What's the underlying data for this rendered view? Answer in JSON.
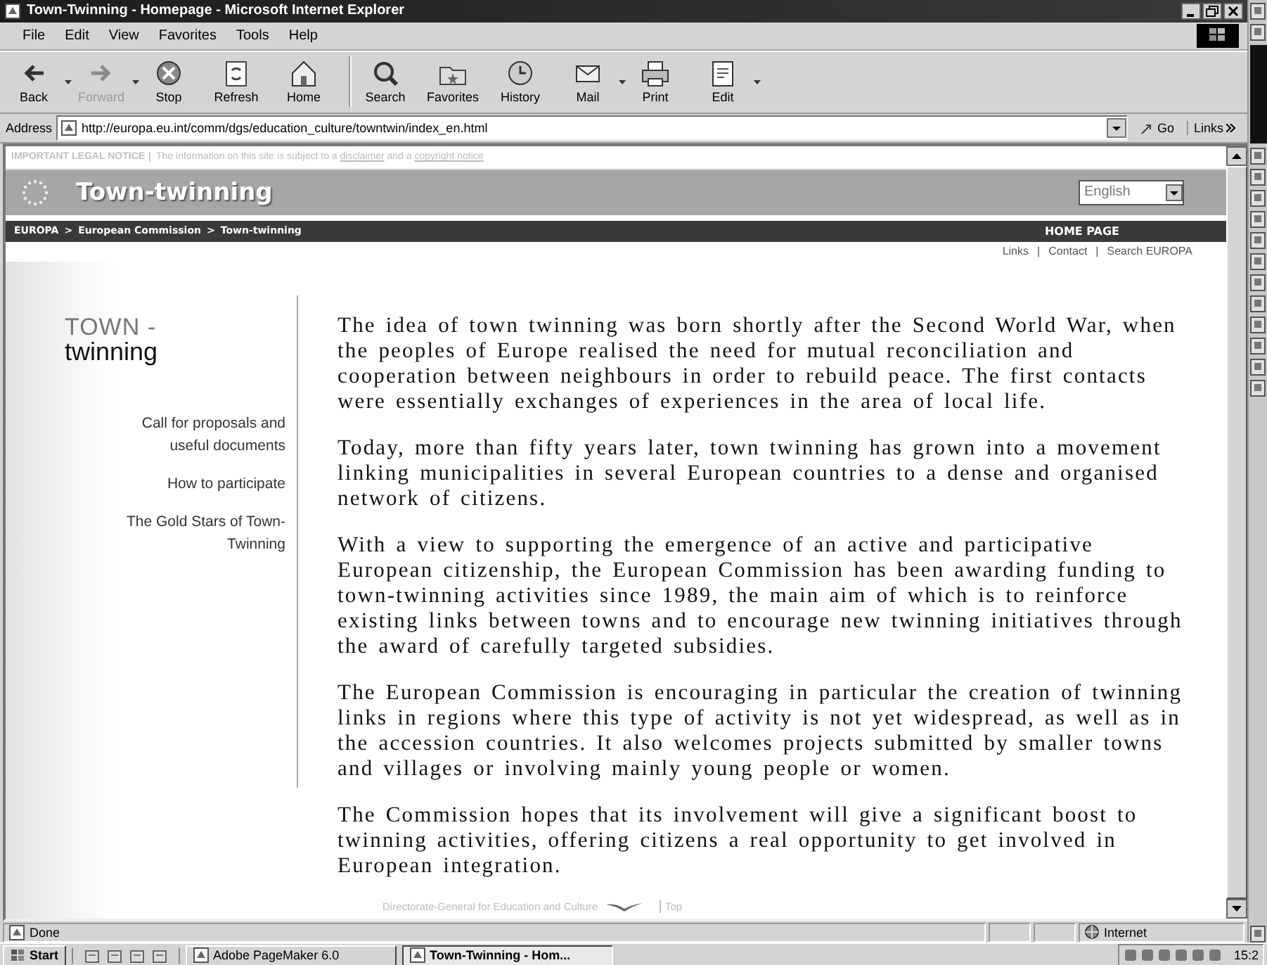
{
  "window": {
    "title": "Town-Twinning - Homepage - Microsoft Internet Explorer"
  },
  "menu": [
    "File",
    "Edit",
    "View",
    "Favorites",
    "Tools",
    "Help"
  ],
  "toolbar": [
    {
      "label": "Back",
      "kind": "back",
      "disabled": false,
      "dropdown": true
    },
    {
      "label": "Forward",
      "kind": "forward",
      "disabled": true,
      "dropdown": true
    },
    {
      "label": "Stop",
      "kind": "stop",
      "disabled": false,
      "dropdown": false
    },
    {
      "label": "Refresh",
      "kind": "refresh",
      "disabled": false,
      "dropdown": false
    },
    {
      "label": "Home",
      "kind": "home",
      "disabled": false,
      "dropdown": false
    },
    {
      "label": "Search",
      "kind": "search",
      "disabled": false,
      "dropdown": false
    },
    {
      "label": "Favorites",
      "kind": "favorites",
      "disabled": false,
      "dropdown": false
    },
    {
      "label": "History",
      "kind": "history",
      "disabled": false,
      "dropdown": false
    },
    {
      "label": "Mail",
      "kind": "mail",
      "disabled": false,
      "dropdown": true
    },
    {
      "label": "Print",
      "kind": "print",
      "disabled": false,
      "dropdown": false
    },
    {
      "label": "Edit",
      "kind": "edit",
      "disabled": false,
      "dropdown": true
    }
  ],
  "address": {
    "label": "Address",
    "value": "http://europa.eu.int/comm/dgs/education_culture/towntwin/index_en.html",
    "go": "Go",
    "links": "Links"
  },
  "page": {
    "legal_notice": {
      "label": "IMPORTANT LEGAL NOTICE",
      "parts": [
        {
          "text": "The information on this site is subject to a",
          "link": false
        },
        {
          "text": "disclaimer",
          "link": true
        },
        {
          "text": "and a",
          "link": false
        },
        {
          "text": "copyright notice",
          "link": true
        }
      ]
    },
    "site_title": "Town-twinning",
    "language": "English",
    "breadcrumb": [
      "EUROPA",
      "European Commission",
      "Town-twinning"
    ],
    "breadcrumb_separator": ">",
    "home_page": "HOME PAGE",
    "top_links": [
      "Links",
      "Contact",
      "Search EUROPA"
    ],
    "top_links_separator": "|",
    "side_title": [
      "TOWN -",
      "twinning"
    ],
    "nav": [
      "Call for proposals and useful documents",
      "How to participate",
      "The Gold Stars of Town-Twinning"
    ],
    "paragraphs": [
      "The idea of town twinning was born shortly after the Second World War, when the peoples of Europe realised the need for mutual reconciliation and cooperation between neighbours in order to rebuild peace. The first contacts were essentially exchanges of experiences in the area of local life.",
      "Today, more than fifty years later, town twinning has grown into a movement linking municipalities in several European countries to a dense and organised network of citizens.",
      "With a view to supporting the emergence of an active and participative European citizenship, the European Commission has been awarding funding to town-twinning activities since 1989, the main aim of which is to reinforce existing links between towns and to encourage new twinning initiatives through the award of carefully targeted subsidies.",
      "The European Commission is encouraging in particular the creation of twinning links in regions where this type of activity is not yet widespread, as well as in the accession countries. It also welcomes projects submitted by smaller towns and villages or involving mainly young people or women.",
      "The Commission hopes that its involvement will give a significant boost to twinning activities, offering citizens a real opportunity to get involved in European integration."
    ],
    "footer": {
      "text": "Directorate-General for Education and Culture",
      "top": "Top"
    }
  },
  "status_bar": {
    "text": "Done",
    "zone": "Internet"
  },
  "taskbar": {
    "start": "Start",
    "tasks": [
      {
        "label": "Adobe PageMaker 6.0",
        "selected": false
      },
      {
        "label": "Town-Twinning - Hom...",
        "selected": true
      }
    ],
    "clock": "15:2"
  }
}
